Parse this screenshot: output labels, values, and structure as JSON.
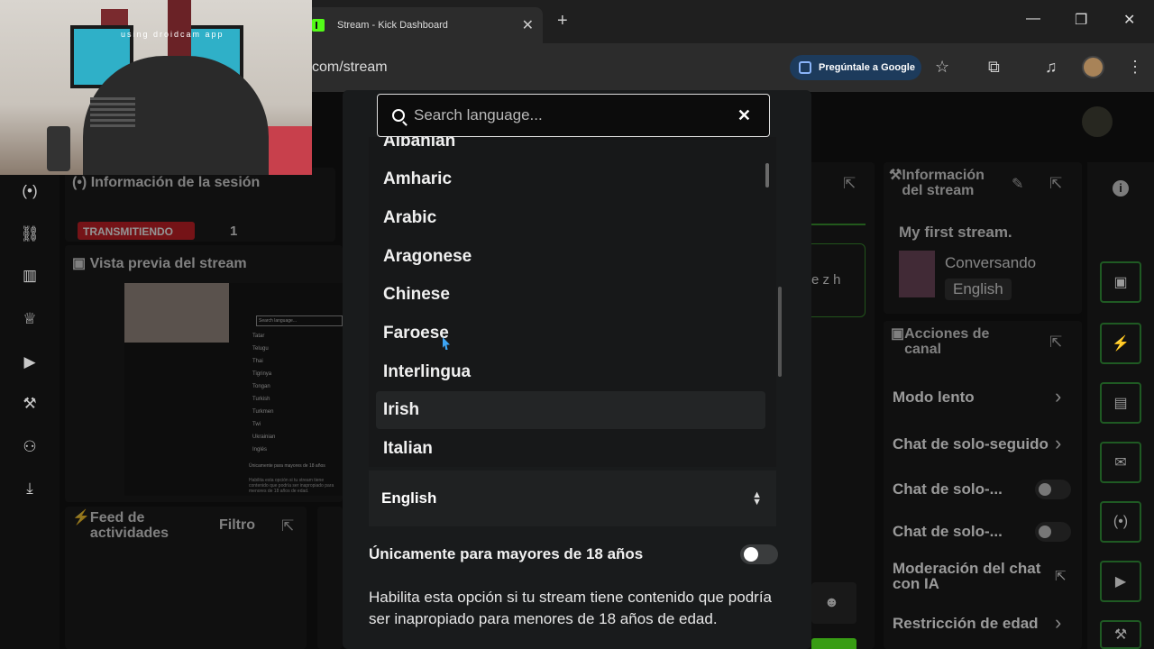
{
  "browser": {
    "tab_title": "Stream - Kick Dashboard",
    "url": "com/stream",
    "ask_google": "Pregúntale a Google"
  },
  "webcam": {
    "watermark": "using droidcam app"
  },
  "session": {
    "title": "Información de la sesión",
    "status_badge": "TRANSMITIENDO",
    "count": "1"
  },
  "preview": {
    "title": "Vista previa del stream"
  },
  "activity": {
    "title_line1": "Feed de",
    "title_line2": "actividades",
    "filter": "Filtro"
  },
  "stream_info": {
    "title_line1": "Información",
    "title_line2": "del stream",
    "stream_title": "My first stream.",
    "category": "Conversando",
    "language_tag": "English"
  },
  "chat_partial": "e z h",
  "channel_actions": {
    "title_line1": "Acciones de",
    "title_line2": "canal",
    "items": [
      {
        "label": "Modo lento"
      },
      {
        "label": "Chat de solo-seguido"
      },
      {
        "label": "Chat de solo-..."
      },
      {
        "label": "Chat de solo-..."
      },
      {
        "label": "Moderación del chat",
        "label2": "con IA"
      },
      {
        "label": "Restricción de edad"
      }
    ]
  },
  "language_modal": {
    "search_placeholder": "Search language...",
    "languages": [
      "Albanian",
      "Amharic",
      "Arabic",
      "Aragonese",
      "Chinese",
      "Faroese",
      "Interlingua",
      "Irish",
      "Italian"
    ],
    "highlighted": "Irish",
    "selected_language": "English",
    "adult_label": "Únicamente para mayores de 18 años",
    "adult_enabled": false,
    "adult_description": "Habilita esta opción si tu stream tiene contenido que podría ser inapropiado para menores de 18 años de edad."
  },
  "mini_preview": {
    "search": "Search language...",
    "langs": [
      "Tatar",
      "Telugu",
      "Thai",
      "Tigrinya",
      "Tongan",
      "Turkish",
      "Turkmen",
      "Twi",
      "Ukrainian"
    ],
    "selected": "Inglés",
    "adult": "Únicamente para mayores de 18 años",
    "desc": "Habilita esta opción si tu stream tiene contenido que podría ser inapropiado para menores de 18 años de edad."
  },
  "icons": {
    "accent": "#53fc18"
  }
}
